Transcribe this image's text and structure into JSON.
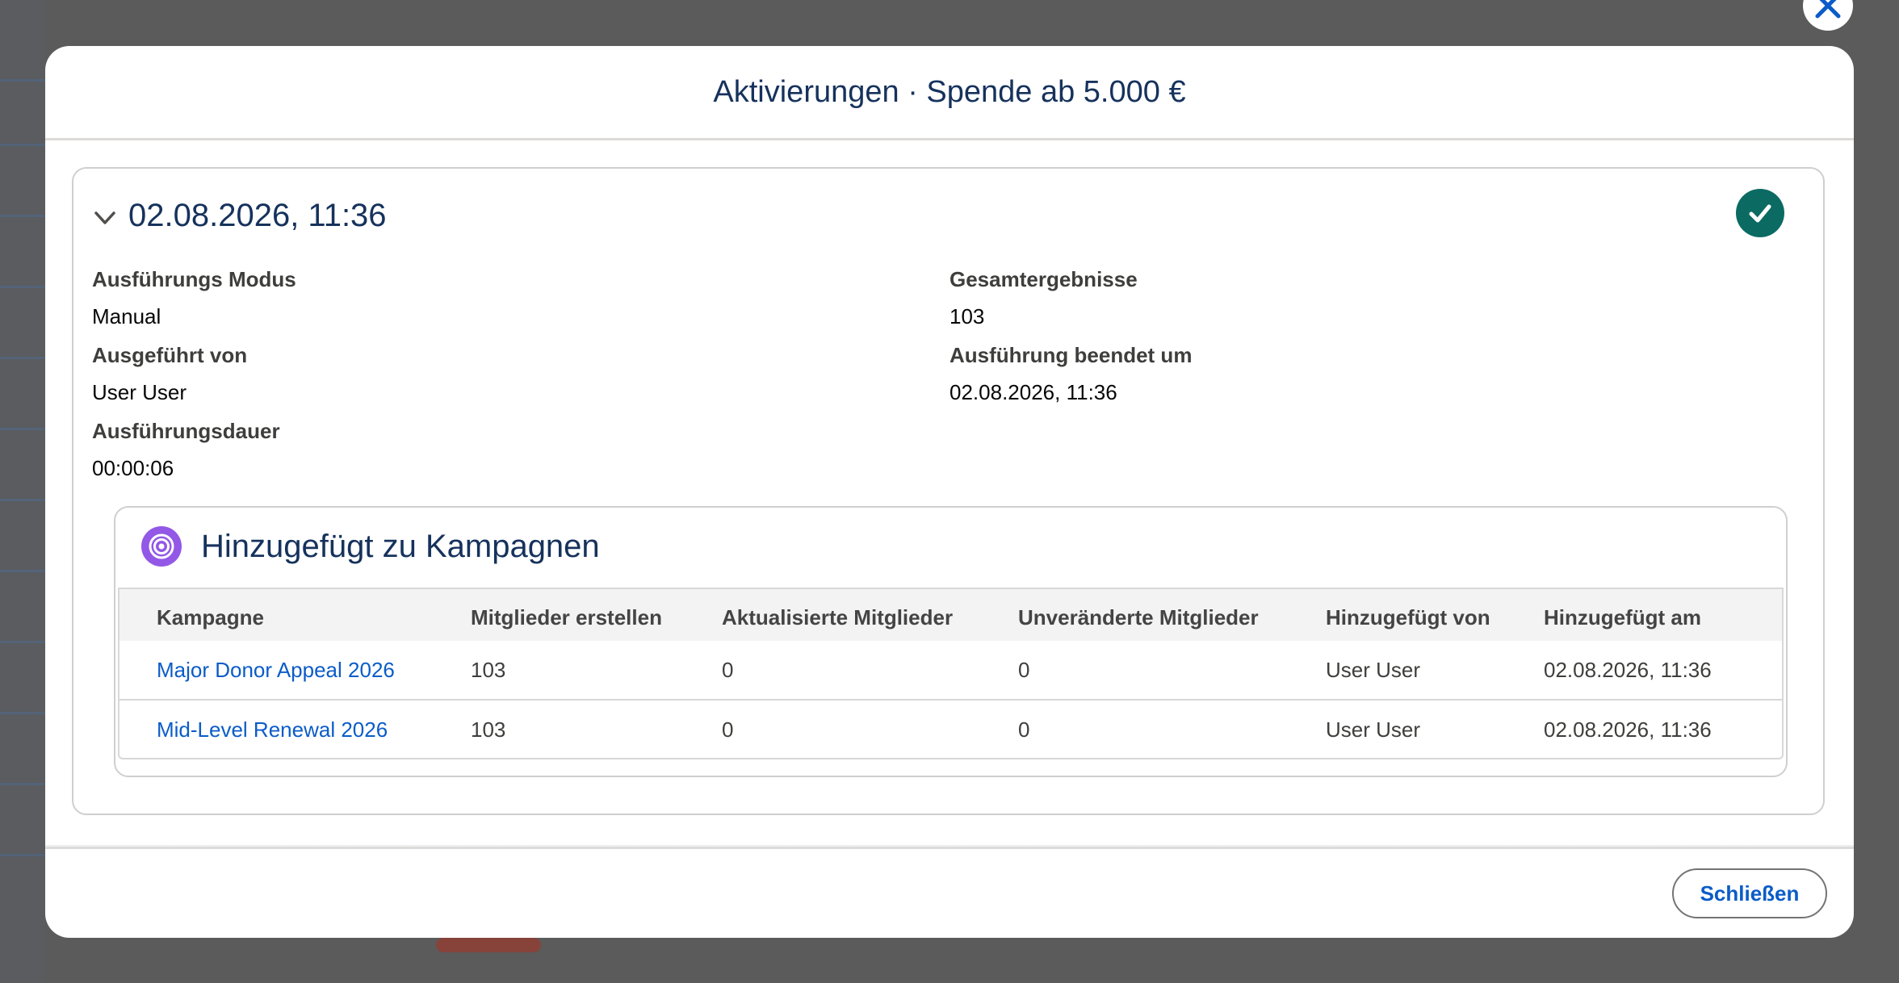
{
  "modal": {
    "title": "Aktivierungen · Spende ab 5.000 €",
    "close_label": "Schließen"
  },
  "run": {
    "datetime": "02.08.2026, 11:36",
    "status_icon": "success-check-icon",
    "status_color": "#0b6b63",
    "fields": {
      "mode_label": "Ausführungs Modus",
      "mode_value": "Manual",
      "by_label": "Ausgeführt von",
      "by_value": "User User",
      "duration_label": "Ausführungsdauer",
      "duration_value": "00:00:06",
      "total_label": "Gesamtergebnisse",
      "total_value": "103",
      "ended_label": "Ausführung beendet um",
      "ended_value": "02.08.2026, 11:36"
    }
  },
  "campaigns": {
    "title": "Hinzugefügt zu Kampagnen",
    "icon": "target-icon",
    "icon_color": "#9358e6",
    "columns": [
      "Kampagne",
      "Mitglieder erstellen",
      "Aktualisierte Mitglieder",
      "Unveränderte Mitglieder",
      "Hinzugefügt von",
      "Hinzugefügt am"
    ],
    "rows": [
      {
        "name": "Major Donor Appeal 2026",
        "created": "103",
        "updated": "0",
        "unchanged": "0",
        "added_by": "User User",
        "added_at": "02.08.2026, 11:36"
      },
      {
        "name": "Mid-Level Renewal 2026",
        "created": "103",
        "updated": "0",
        "unchanged": "0",
        "added_by": "User User",
        "added_at": "02.08.2026, 11:36"
      }
    ]
  },
  "colors": {
    "accent": "#0b5cc8",
    "heading": "#16325c"
  }
}
